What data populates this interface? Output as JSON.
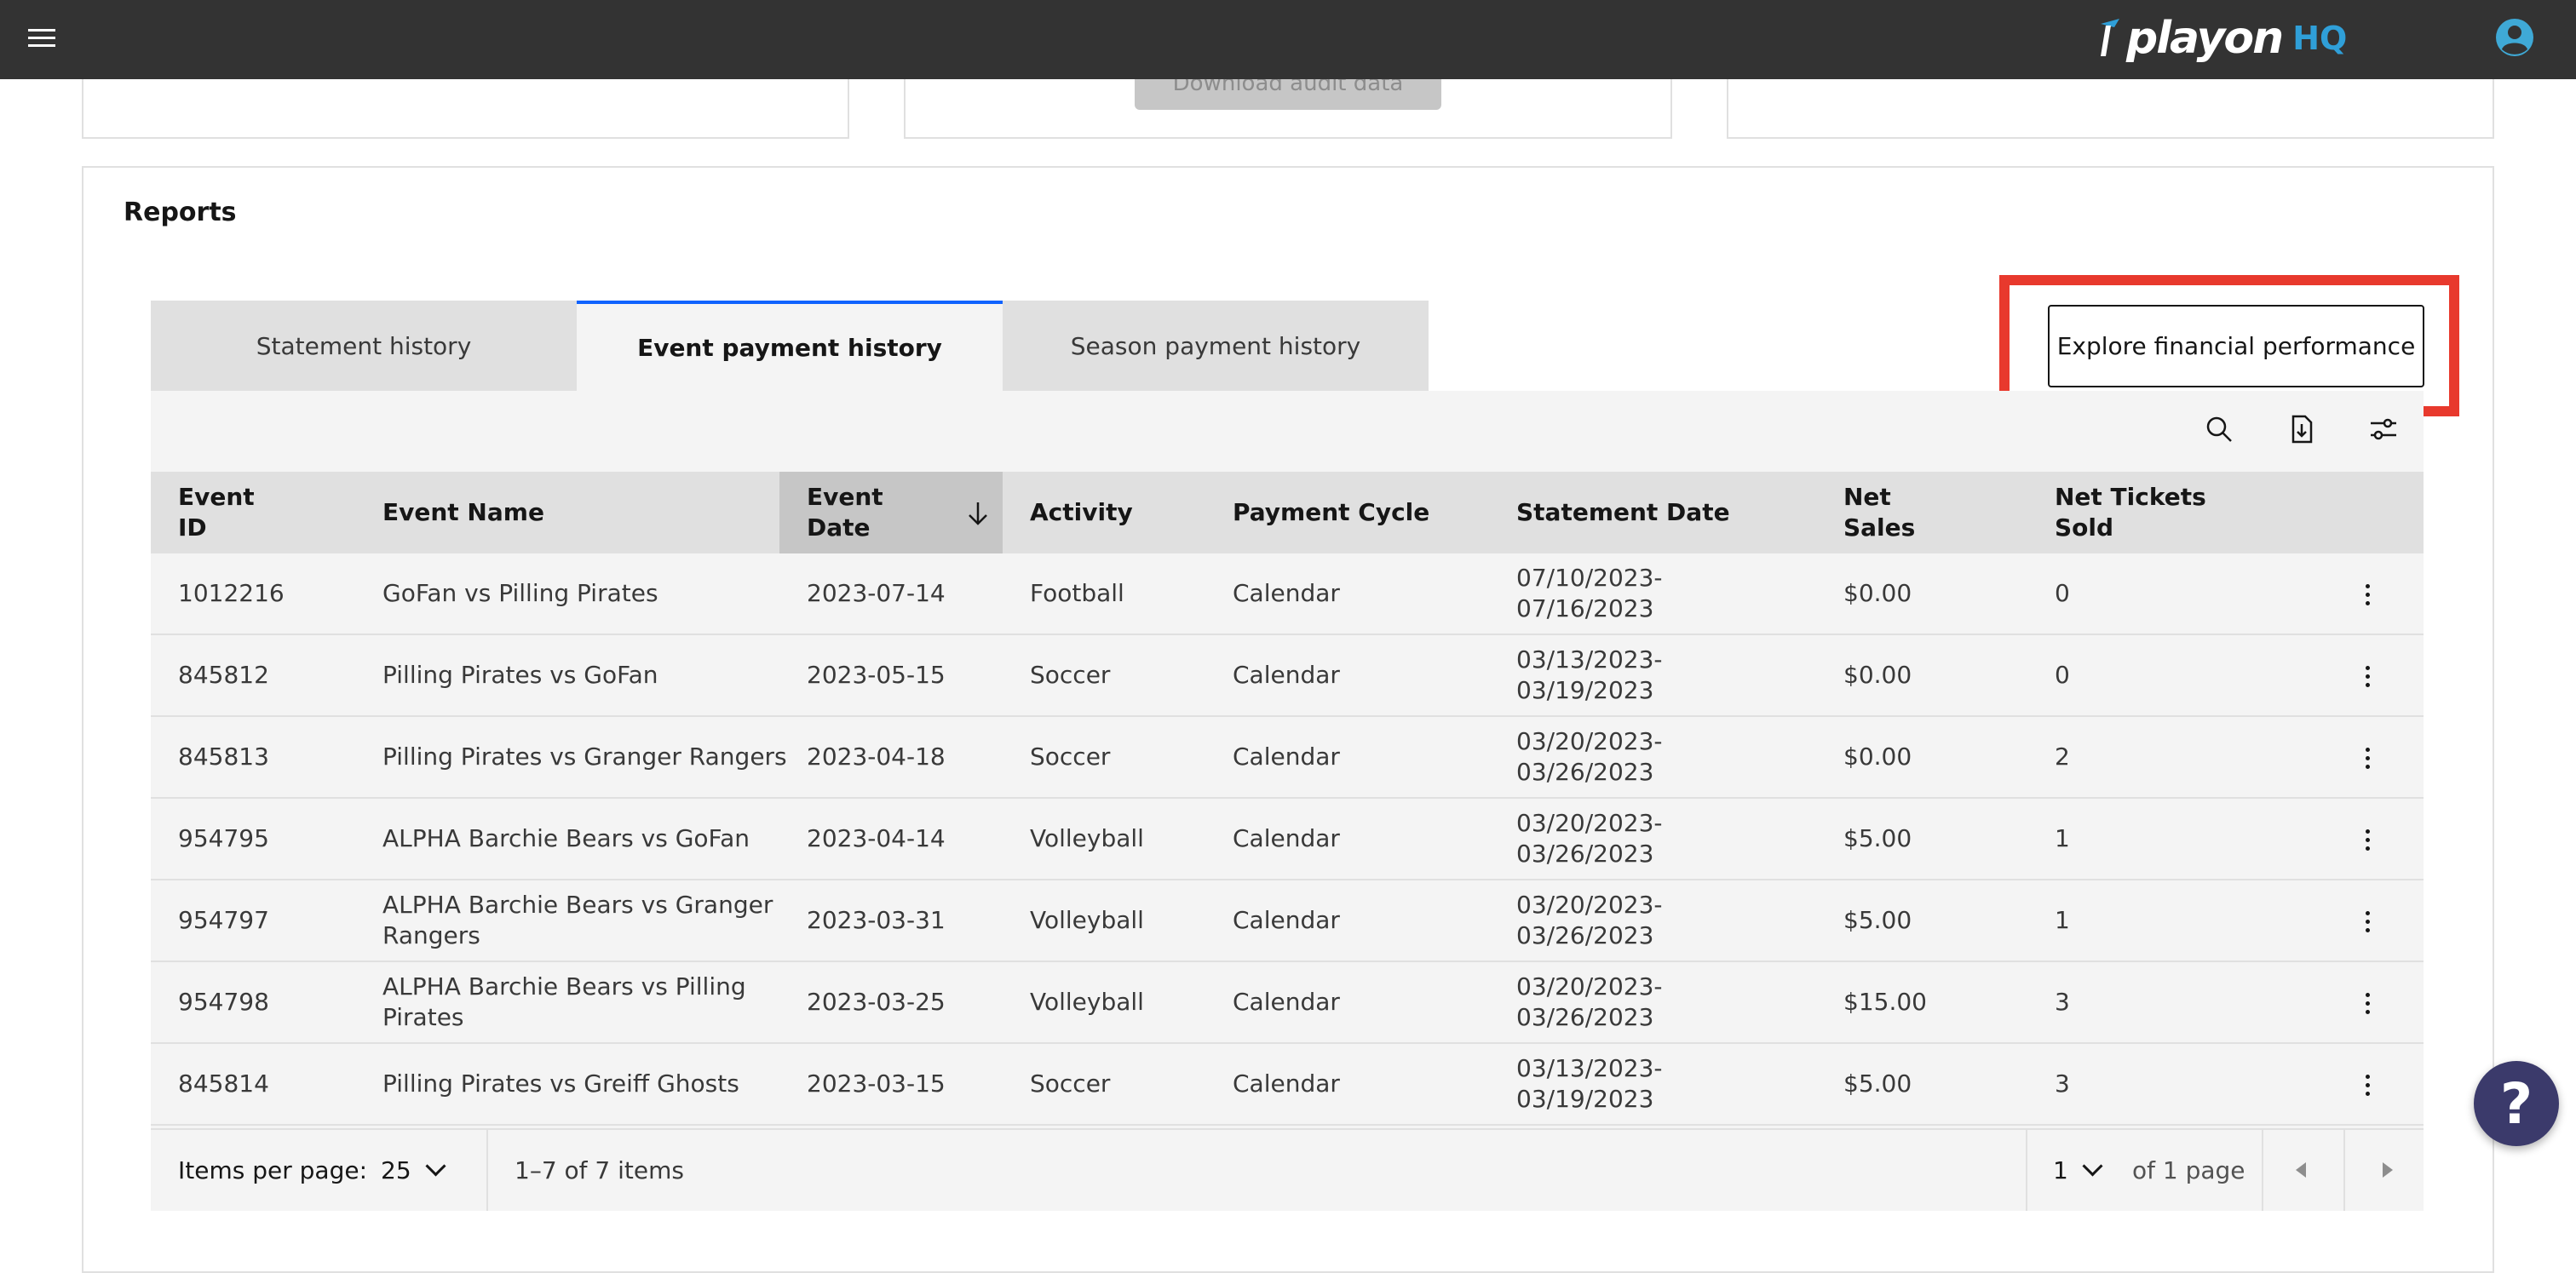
{
  "header": {
    "logo_word": "playon",
    "logo_suffix": "HQ",
    "colors": {
      "bar": "#333333",
      "logo_accent": "#2f9fd8",
      "user_icon": "#3fa9d6"
    }
  },
  "top_cards": {
    "audit_button_label": "Download audit data"
  },
  "reports": {
    "title": "Reports",
    "tabs": [
      {
        "label": "Statement history",
        "active": false
      },
      {
        "label": "Event payment history",
        "active": true
      },
      {
        "label": "Season payment history",
        "active": false
      }
    ],
    "explore_button": "Explore financial performance",
    "toolbar_icons": [
      "search-icon",
      "download-file-icon",
      "settings-adjust-icon"
    ],
    "columns": [
      "Event\nID",
      "Event Name",
      "Event\nDate",
      "Activity",
      "Payment Cycle",
      "Statement Date",
      "Net\nSales",
      "Net Tickets\nSold"
    ],
    "sort": {
      "column": "Event Date",
      "direction": "descending"
    },
    "rows": [
      {
        "id": "1012216",
        "name": "GoFan vs Pilling Pirates",
        "date": "2023-07-14",
        "activity": "Football",
        "cycle": "Calendar",
        "statement": "07/10/2023-\n07/16/2023",
        "sales": "$0.00",
        "tickets": "0"
      },
      {
        "id": "845812",
        "name": "Pilling Pirates vs GoFan",
        "date": "2023-05-15",
        "activity": "Soccer",
        "cycle": "Calendar",
        "statement": "03/13/2023-\n03/19/2023",
        "sales": "$0.00",
        "tickets": "0"
      },
      {
        "id": "845813",
        "name": "Pilling Pirates vs Granger Rangers",
        "date": "2023-04-18",
        "activity": "Soccer",
        "cycle": "Calendar",
        "statement": "03/20/2023-\n03/26/2023",
        "sales": "$0.00",
        "tickets": "2"
      },
      {
        "id": "954795",
        "name": "ALPHA Barchie Bears vs GoFan",
        "date": "2023-04-14",
        "activity": "Volleyball",
        "cycle": "Calendar",
        "statement": "03/20/2023-\n03/26/2023",
        "sales": "$5.00",
        "tickets": "1"
      },
      {
        "id": "954797",
        "name": "ALPHA Barchie Bears vs Granger\nRangers",
        "date": "2023-03-31",
        "activity": "Volleyball",
        "cycle": "Calendar",
        "statement": "03/20/2023-\n03/26/2023",
        "sales": "$5.00",
        "tickets": "1"
      },
      {
        "id": "954798",
        "name": "ALPHA Barchie Bears vs Pilling\nPirates",
        "date": "2023-03-25",
        "activity": "Volleyball",
        "cycle": "Calendar",
        "statement": "03/20/2023-\n03/26/2023",
        "sales": "$15.00",
        "tickets": "3"
      },
      {
        "id": "845814",
        "name": "Pilling Pirates vs Greiff Ghosts",
        "date": "2023-03-15",
        "activity": "Soccer",
        "cycle": "Calendar",
        "statement": "03/13/2023-\n03/19/2023",
        "sales": "$5.00",
        "tickets": "3"
      }
    ],
    "pagination": {
      "items_per_page_label": "Items per page:",
      "items_per_page": "25",
      "range_text": "1–7 of 7 items",
      "page": "1",
      "page_total_text": "of 1 page"
    }
  },
  "help_button": "?"
}
